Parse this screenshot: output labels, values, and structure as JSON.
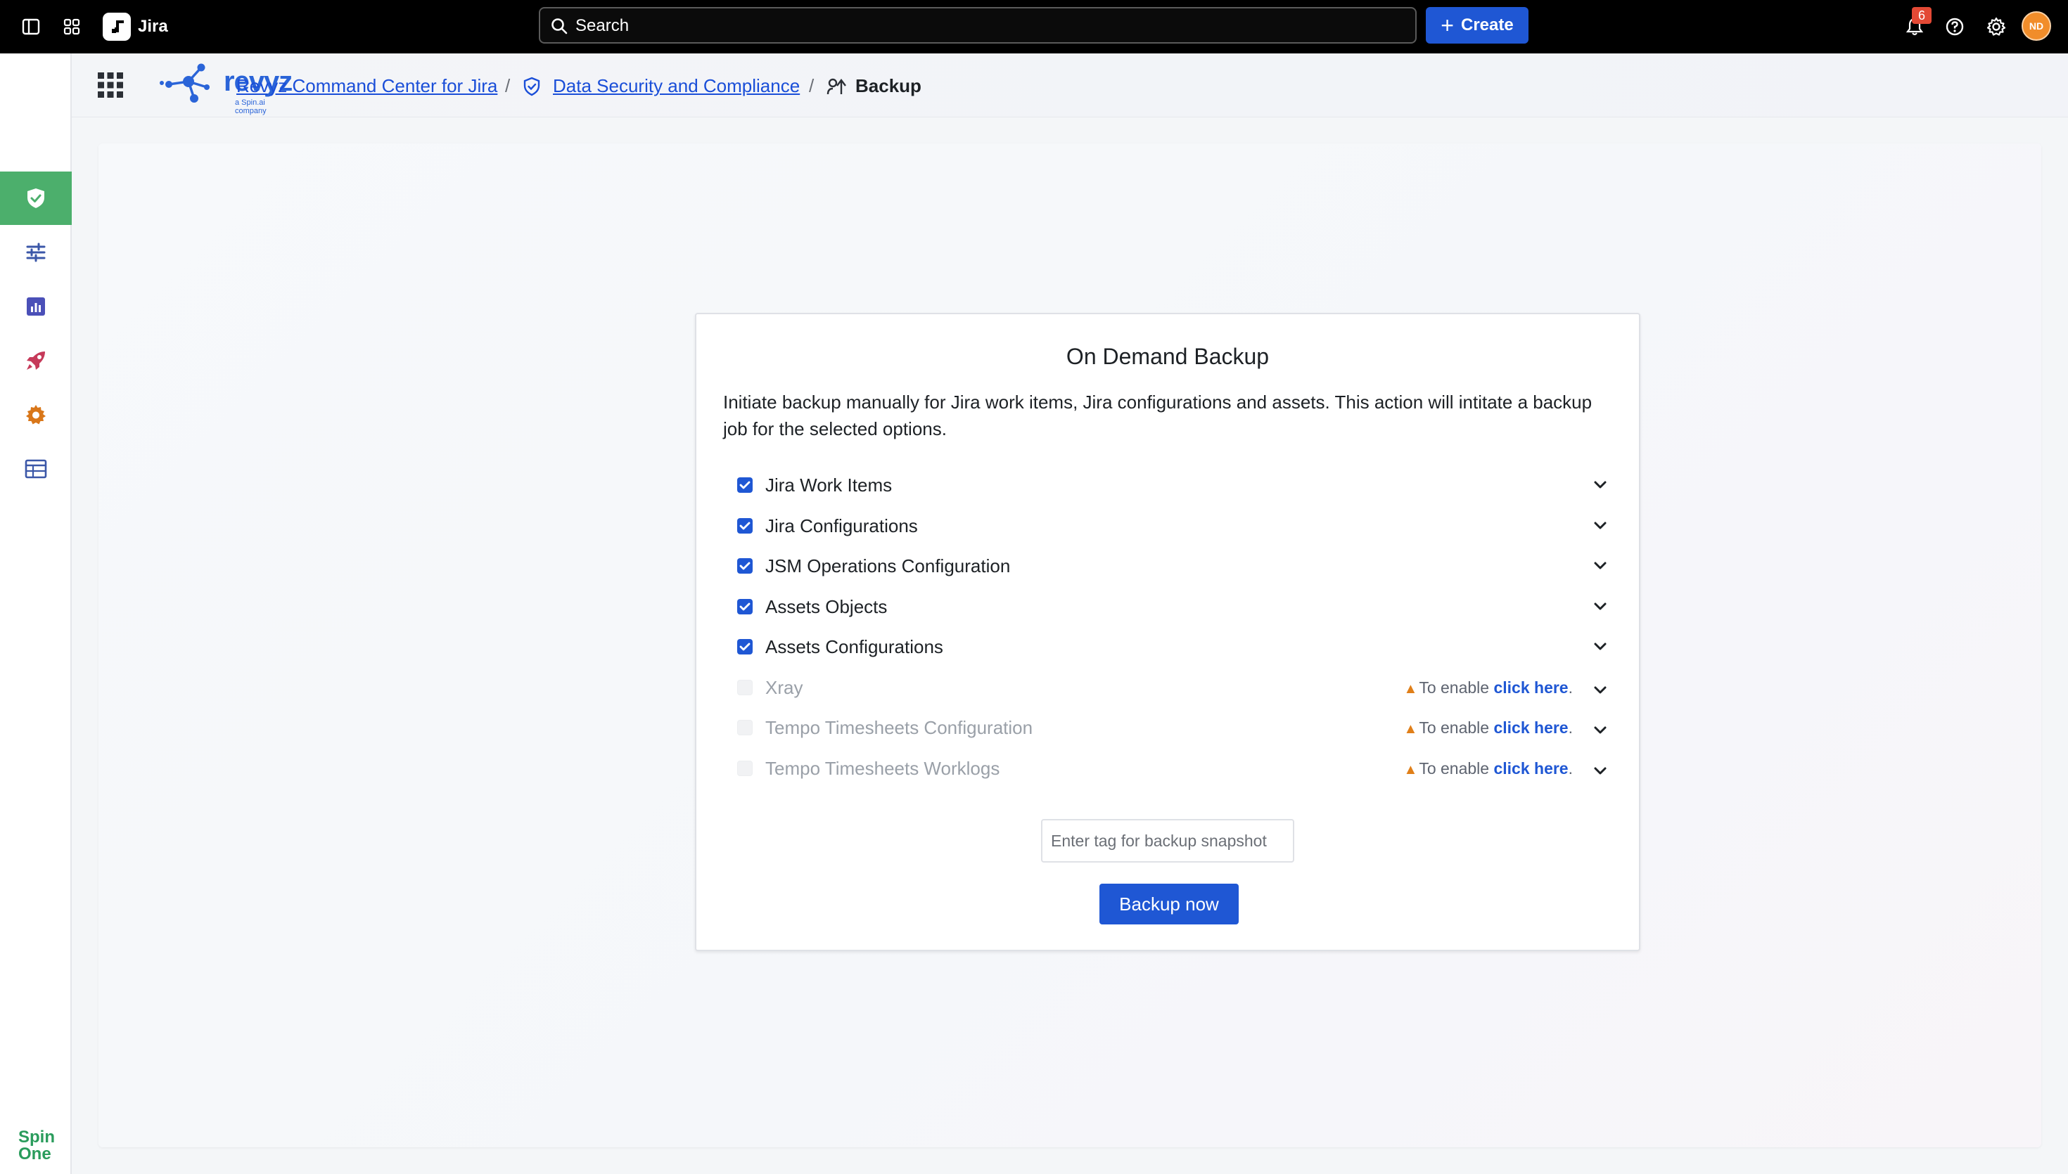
{
  "topbar": {
    "app_name": "Jira",
    "search_placeholder": "Search",
    "create_label": "Create",
    "notification_count": "6",
    "avatar_initials": "ND"
  },
  "sidebar": {
    "items": [
      {
        "name": "home-icon"
      },
      {
        "name": "shield-icon",
        "active": true
      },
      {
        "name": "sliders-icon"
      },
      {
        "name": "report-icon"
      },
      {
        "name": "rocket-icon"
      },
      {
        "name": "gear-icon"
      },
      {
        "name": "table-icon"
      }
    ],
    "footer_logo": "Spin One"
  },
  "header": {
    "logo_text": "revyz",
    "logo_subtext": "a Spin.ai company",
    "breadcrumb": {
      "app": "Revyz Command Center for Jira",
      "section": "Data Security and Compliance",
      "current": "Backup",
      "separator": "/"
    }
  },
  "card": {
    "title": "On Demand Backup",
    "description": "Initiate backup manually for Jira work items, Jira configurations and assets. This action will intitate a backup job for the selected options.",
    "options": [
      {
        "label": "Jira Work Items",
        "checked": true,
        "enabled": true
      },
      {
        "label": "Jira Configurations",
        "checked": true,
        "enabled": true
      },
      {
        "label": "JSM Operations Configuration",
        "checked": true,
        "enabled": true
      },
      {
        "label": "Assets Objects",
        "checked": true,
        "enabled": true
      },
      {
        "label": "Assets Configurations",
        "checked": true,
        "enabled": true
      },
      {
        "label": "Xray",
        "checked": false,
        "enabled": false
      },
      {
        "label": "Tempo Timesheets Configuration",
        "checked": false,
        "enabled": false
      },
      {
        "label": "Tempo Timesheets Worklogs",
        "checked": false,
        "enabled": false
      }
    ],
    "enable_prefix": "To enable ",
    "enable_link": "click here",
    "enable_suffix": ".",
    "tag_placeholder": "Enter tag for backup snapshot",
    "backup_button": "Backup now"
  },
  "colors": {
    "accent": "#1f57d4",
    "sidebar_active": "#4caf6c",
    "warning": "#e07f19"
  }
}
